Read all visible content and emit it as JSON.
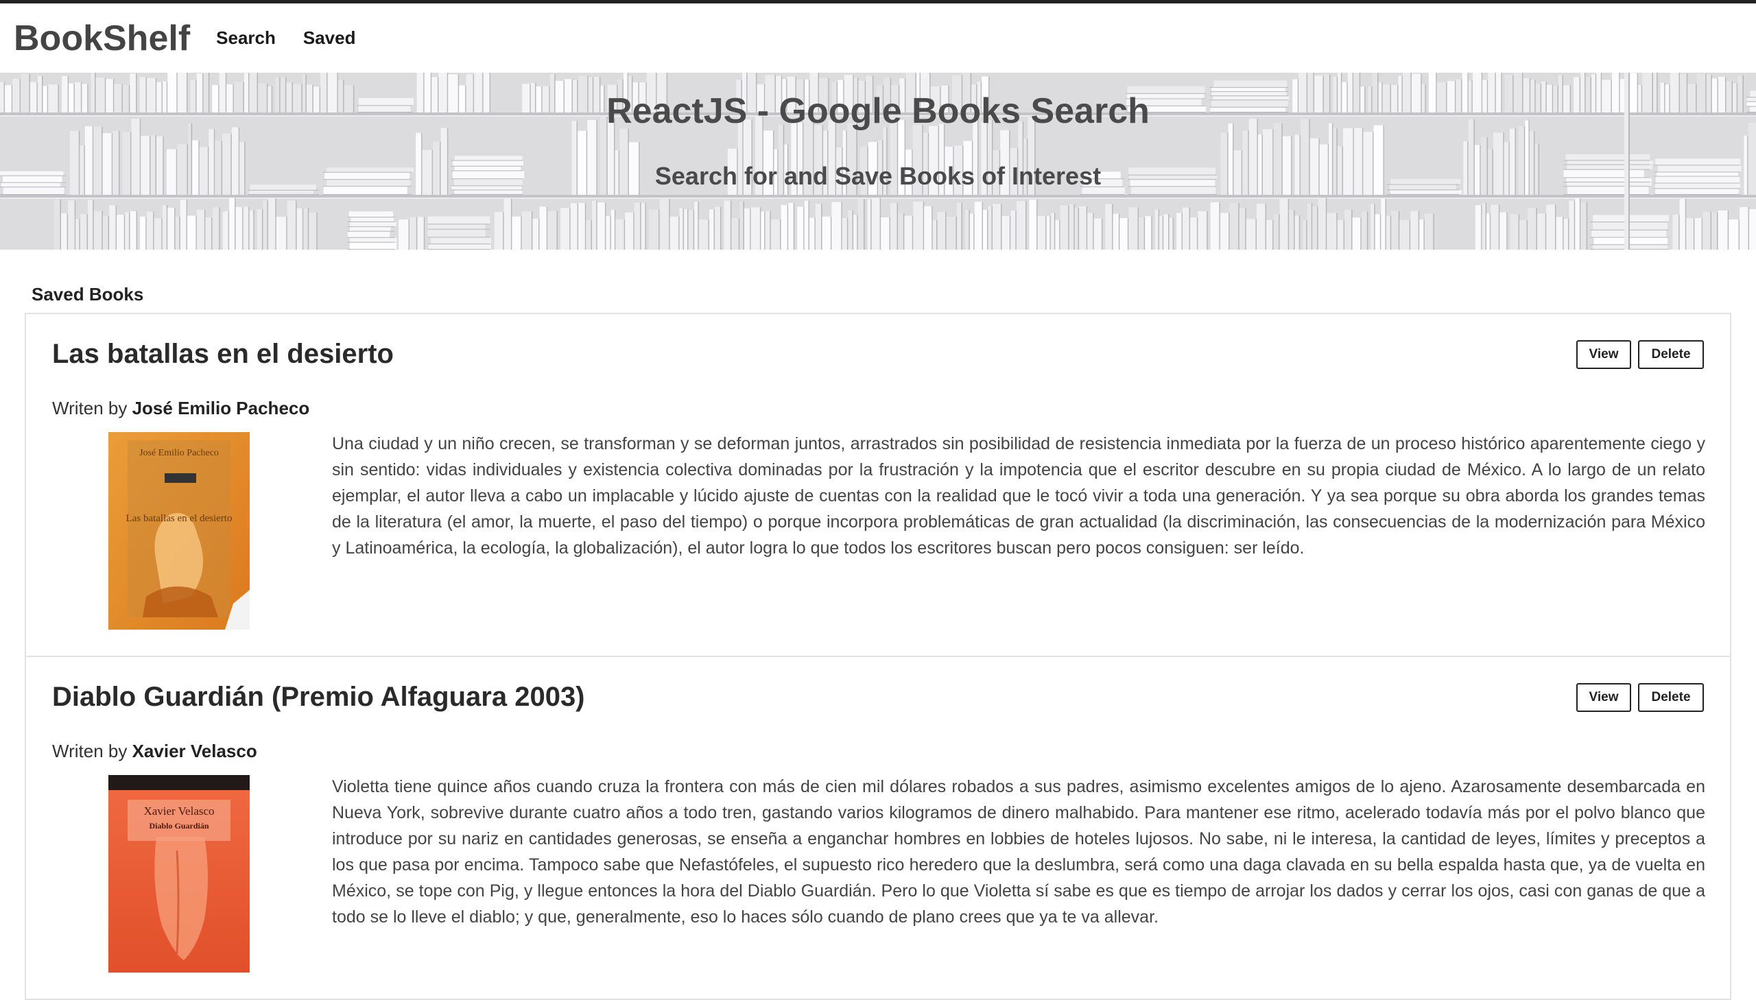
{
  "navbar": {
    "brand": "BookShelf",
    "links": [
      "Search",
      "Saved"
    ]
  },
  "jumbotron": {
    "title": "ReactJS - Google Books Search",
    "subtitle": "Search for and Save Books of Interest"
  },
  "saved": {
    "heading": "Saved Books",
    "written_by_prefix": "Writen by",
    "view_label": "View",
    "delete_label": "Delete",
    "books": [
      {
        "title": "Las batallas en el desierto",
        "author": "José Emilio Pacheco",
        "cover_author": "José Emilio Pacheco",
        "cover_title": "Las batallas en el desierto",
        "description": "Una ciudad y un niño crecen, se transforman y se deforman juntos, arrastrados sin posibilidad de resistencia inmediata por la fuerza de un proceso histórico aparentemente ciego y sin sentido: vidas individuales y existencia colectiva dominadas por la frustración y la impotencia que el escritor descubre en su propia ciudad de México. A lo largo de un relato ejemplar, el autor lleva a cabo un implacable y lúcido ajuste de cuentas con la realidad que le tocó vivir a toda una generación. Y ya sea porque su obra aborda los grandes temas de la literatura (el amor, la muerte, el paso del tiempo) o porque incorpora problemáticas de gran actualidad (la discriminación, las consecuencias de la modernización para México y Latinoamérica, la ecología, la globalización), el autor logra lo que todos los escritores buscan pero pocos consiguen: ser leído."
      },
      {
        "title": "Diablo Guardián (Premio Alfaguara 2003)",
        "author": "Xavier Velasco",
        "cover_author": "Xavier Velasco",
        "cover_title": "Diablo Guardián",
        "description": "Violetta tiene quince años cuando cruza la frontera con más de cien mil dólares robados a sus padres, asimismo excelentes amigos de lo ajeno. Azarosamente desembarcada en Nueva York, sobrevive durante cuatro años a todo tren, gastando varios kilogramos de dinero malhabido. Para mantener ese ritmo, acelerado todavía más por el polvo blanco que introduce por su nariz en cantidades generosas, se enseña a enganchar hombres en lobbies de hoteles lujosos. No sabe, ni le interesa, la cantidad de leyes, límites y preceptos a los que pasa por encima. Tampoco sabe que Nefastófeles, el supuesto rico heredero que la deslumbra, será como una daga clavada en su bella espalda hasta que, ya de vuelta en México, se tope con Pig, y llegue entonces la hora del Diablo Guardián. Pero lo que Violetta sí sabe es que es tiempo de arrojar los dados y cerrar los ojos, casi con ganas de que a todo se lo lleve el diablo; y que, generalmente, eso lo haces sólo cuando de plano crees que ya te va allevar."
      }
    ]
  }
}
